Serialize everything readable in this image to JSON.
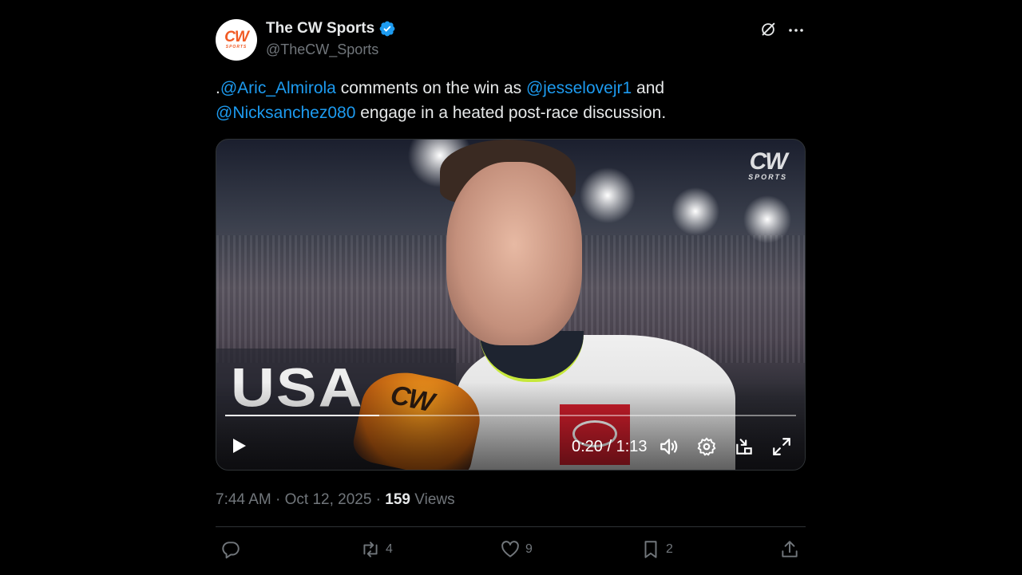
{
  "account": {
    "name": "The CW Sports",
    "handle": "@TheCW_Sports",
    "avatar_text": "CW",
    "avatar_subtext": "SPORTS"
  },
  "tweet": {
    "text_prefix": ".",
    "mention_1": "@Aric_Almirola",
    "text_mid_1": " comments on the win as ",
    "mention_2": "@jesselovejr1",
    "text_mid_2": " and ",
    "mention_3": "@Nicksanchez080",
    "text_end": " engage in a heated post-race discussion."
  },
  "video": {
    "watermark_main": "CW",
    "watermark_sub": "SPORTS",
    "time": "0:20 / 1:13",
    "progress": 0.27,
    "background_text": "USA",
    "mic_text": "CW"
  },
  "meta": {
    "time": "7:44 AM",
    "sep1": " · ",
    "date": "Oct 12, 2025",
    "sep2": " · ",
    "views_count": "159",
    "views_label": " Views"
  },
  "actions": {
    "replies": "",
    "reposts": "4",
    "likes": "9",
    "bookmarks": "2"
  },
  "colors": {
    "accent": "#1d9bf0",
    "muted": "#71767b",
    "brand_orange": "#f15a24"
  }
}
